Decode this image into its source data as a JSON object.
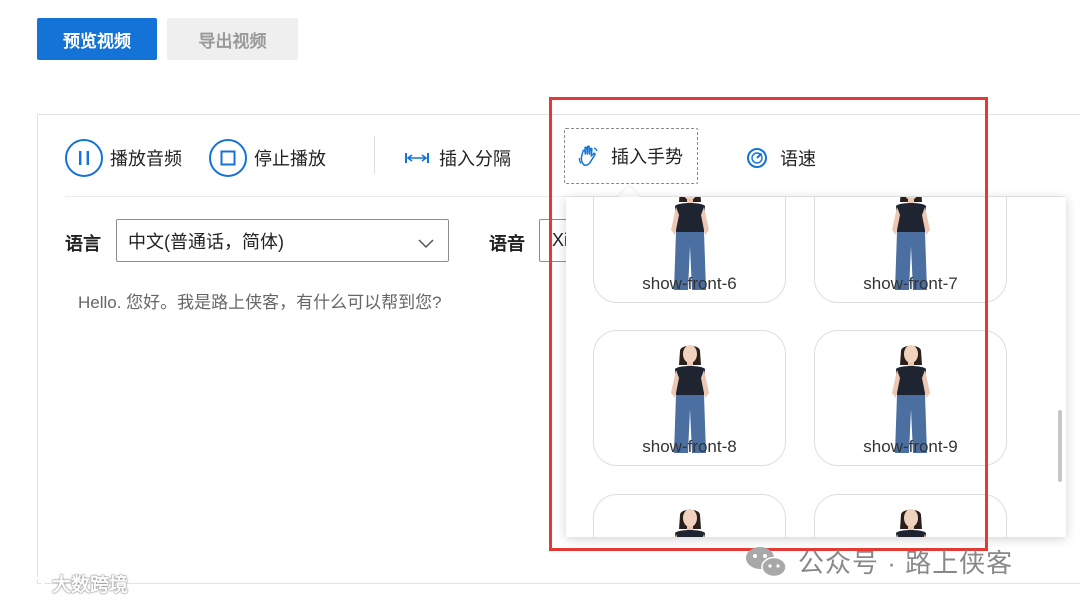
{
  "top_buttons": {
    "preview": "预览视频",
    "export": "导出视频"
  },
  "toolbar": {
    "play_audio": "播放音频",
    "stop_play": "停止播放",
    "insert_break": "插入分隔",
    "insert_gesture": "插入手势",
    "speed": "语速"
  },
  "form": {
    "language_label": "语言",
    "language_value": "中文(普通话，简体)",
    "voice_label": "语音",
    "voice_value": "Xi"
  },
  "editor": {
    "text": "Hello. 您好。我是路上侠客，有什么可以帮到您?"
  },
  "gesture_cards": [
    {
      "name": "show-front-6"
    },
    {
      "name": "show-front-7"
    },
    {
      "name": "show-front-8"
    },
    {
      "name": "show-front-9"
    },
    {
      "name": ""
    },
    {
      "name": ""
    }
  ],
  "watermarks": {
    "left": "大数跨境",
    "right": "公众号 · 路上侠客"
  },
  "colors": {
    "accent": "#1473d6",
    "highlight": "#e53935",
    "shirt": "#1f2530",
    "jeans": "#4a6fa0"
  }
}
